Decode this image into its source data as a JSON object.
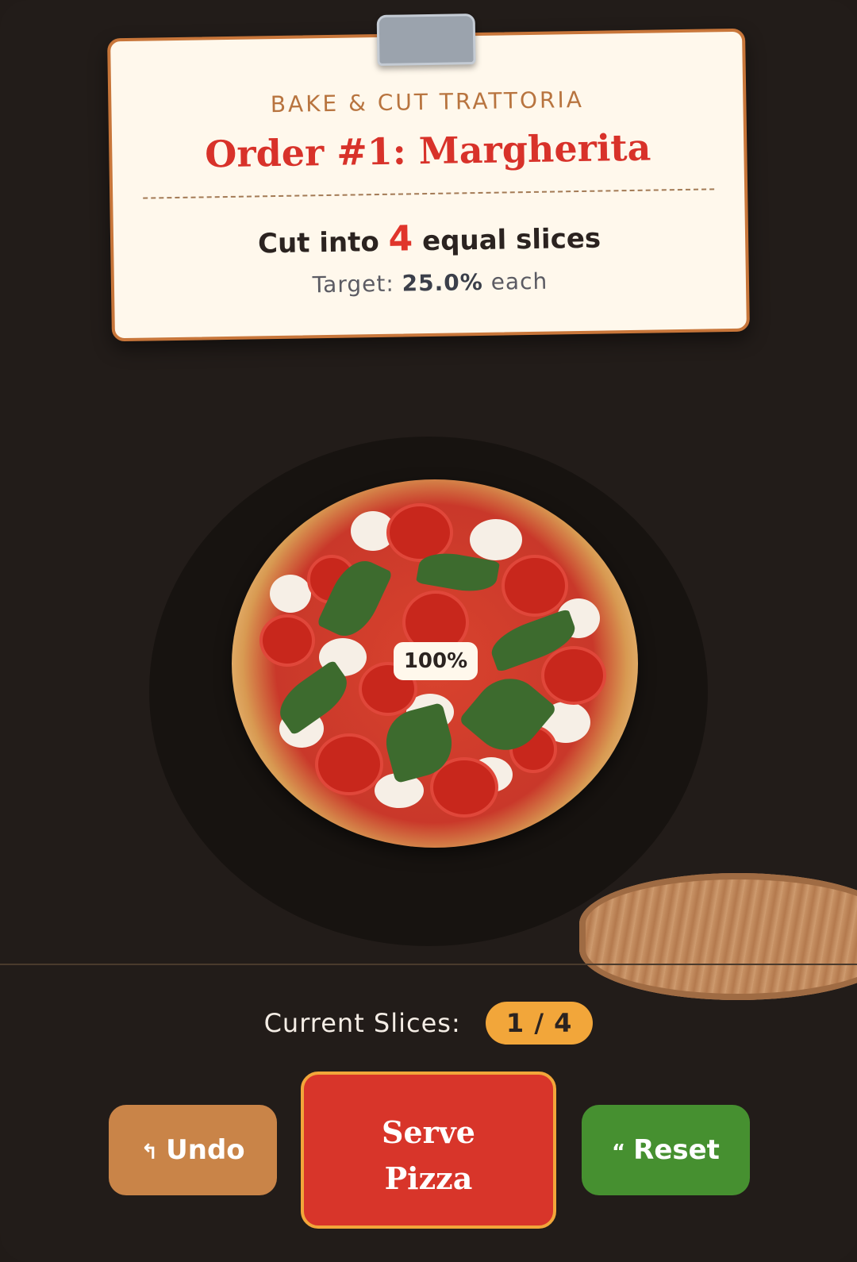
{
  "ticket": {
    "restaurant": "BAKE & CUT TRATTORIA",
    "order_title": "Order #1: Margherita",
    "instruction_prefix": "Cut into",
    "slice_count": "4",
    "instruction_suffix": "equal slices",
    "target_prefix": "Target:",
    "target_value": "25.0%",
    "target_suffix": "each"
  },
  "board": {
    "pizza_percentage": "100%"
  },
  "status": {
    "current_slices_label": "Current Slices:",
    "current_slices_value": "1 / 4"
  },
  "buttons": {
    "undo_icon": "↰",
    "undo_label": "Undo",
    "serve_line1": "Serve",
    "serve_line2": "Pizza",
    "reset_icon": "“",
    "reset_label": "Reset"
  },
  "colors": {
    "background": "#221c19",
    "ticket_bg": "#fff8ec",
    "accent_red": "#d8352a",
    "accent_orange": "#f2a63a",
    "undo": "#c98448",
    "reset": "#469030"
  }
}
